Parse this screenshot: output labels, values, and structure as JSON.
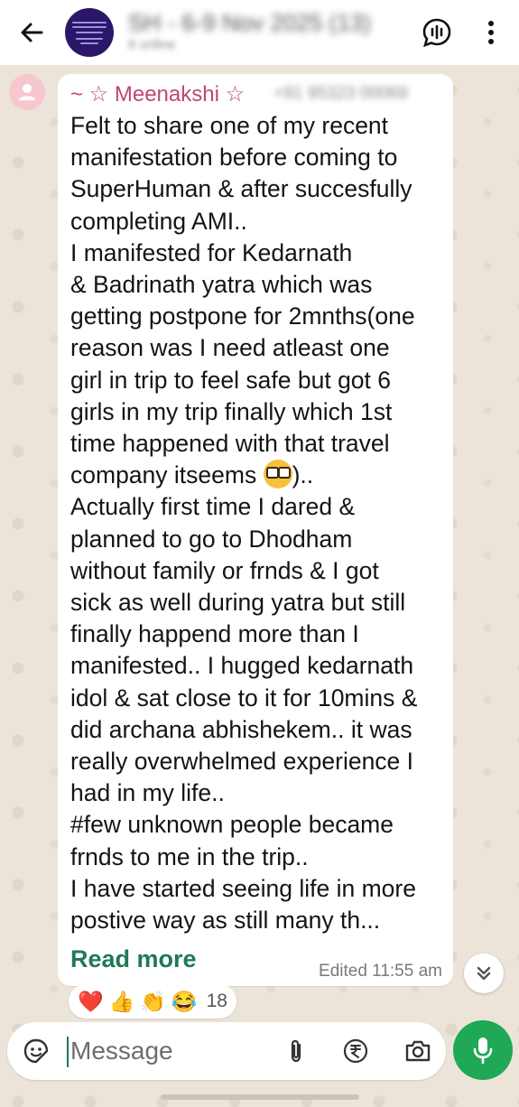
{
  "header": {
    "group_name": "SH - 6-9 Nov 2025 (13)",
    "subtitle": "6 online",
    "icons": [
      "back-arrow-icon",
      "voice-chat-icon",
      "more-vertical-icon"
    ]
  },
  "message": {
    "sender_name": "~ ☆ Meenakshi ☆",
    "sender_phone": "+91 95323 00069",
    "lines": [
      "Felt to share one of my recent",
      "manifestation before coming to",
      "SuperHuman & after succesfully",
      "completing AMI..",
      "I manifested for Kedarnath",
      "& Badrinath yatra which was",
      "getting postpone for 2mnths(one",
      "reason was I need atleast one",
      "girl in trip to feel safe but got 6",
      "girls in my trip finally which 1st",
      "time happened with that travel",
      "company itseems",
      "Actually first time I dared &",
      "planned to go to Dhodham",
      "without family or frnds & I got",
      "sick as well during yatra but still",
      "finally happend more than I",
      "manifested.. I hugged kedarnath",
      "idol & sat close to it for 10mins &",
      "did archana abhishekem.. it was",
      "really overwhelmed experience I",
      "had in my life..",
      "#few unknown people became",
      "frnds to me in the trip..",
      "I have started seeing life in more",
      "postive way as still many th..."
    ],
    "line12_suffix": ")..",
    "read_more": "Read more",
    "edited_time": "Edited 11:55 am"
  },
  "reactions": {
    "emojis": [
      "❤️",
      "👍",
      "👏",
      "😂"
    ],
    "count": "18"
  },
  "composer": {
    "placeholder": "Message",
    "icons": [
      "sticker-icon",
      "attach-icon",
      "rupee-payment-icon",
      "camera-icon",
      "mic-icon"
    ]
  },
  "colors": {
    "accent_green": "#1fa855",
    "link_green": "#1f7a53",
    "sender_pink": "#c0467a",
    "group_avatar": "#2a1768"
  }
}
